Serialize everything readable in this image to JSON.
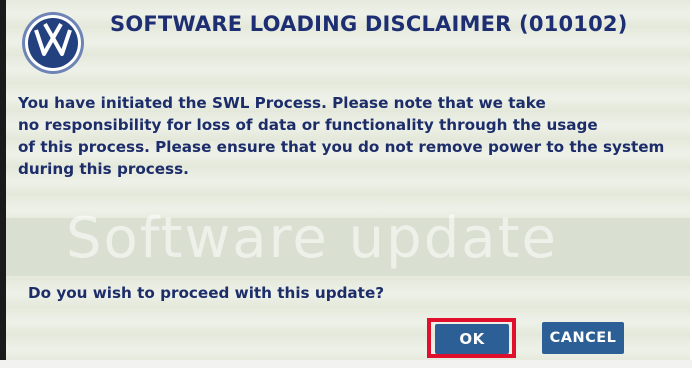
{
  "dialog": {
    "title": "SOFTWARE LOADING DISCLAIMER (010102)",
    "message_lines": [
      "You have initiated the SWL Process. Please note that we take",
      "no responsibility for loss of data or functionality through the usage",
      "of this process. Please ensure that you do not remove power to the system",
      "during this process."
    ],
    "background_text": "Software update",
    "prompt": "Do you wish to proceed with this update?",
    "buttons": {
      "ok_label": "OK",
      "cancel_label": "CANCEL"
    },
    "highlighted_button": "OK"
  },
  "logo": {
    "icon": "vw-logo-icon"
  },
  "colors": {
    "text_blue": "#1c2d6a",
    "button_blue": "#2c5f95",
    "highlight_red": "#e0102c",
    "screen_bg": "#e8ecdf"
  }
}
